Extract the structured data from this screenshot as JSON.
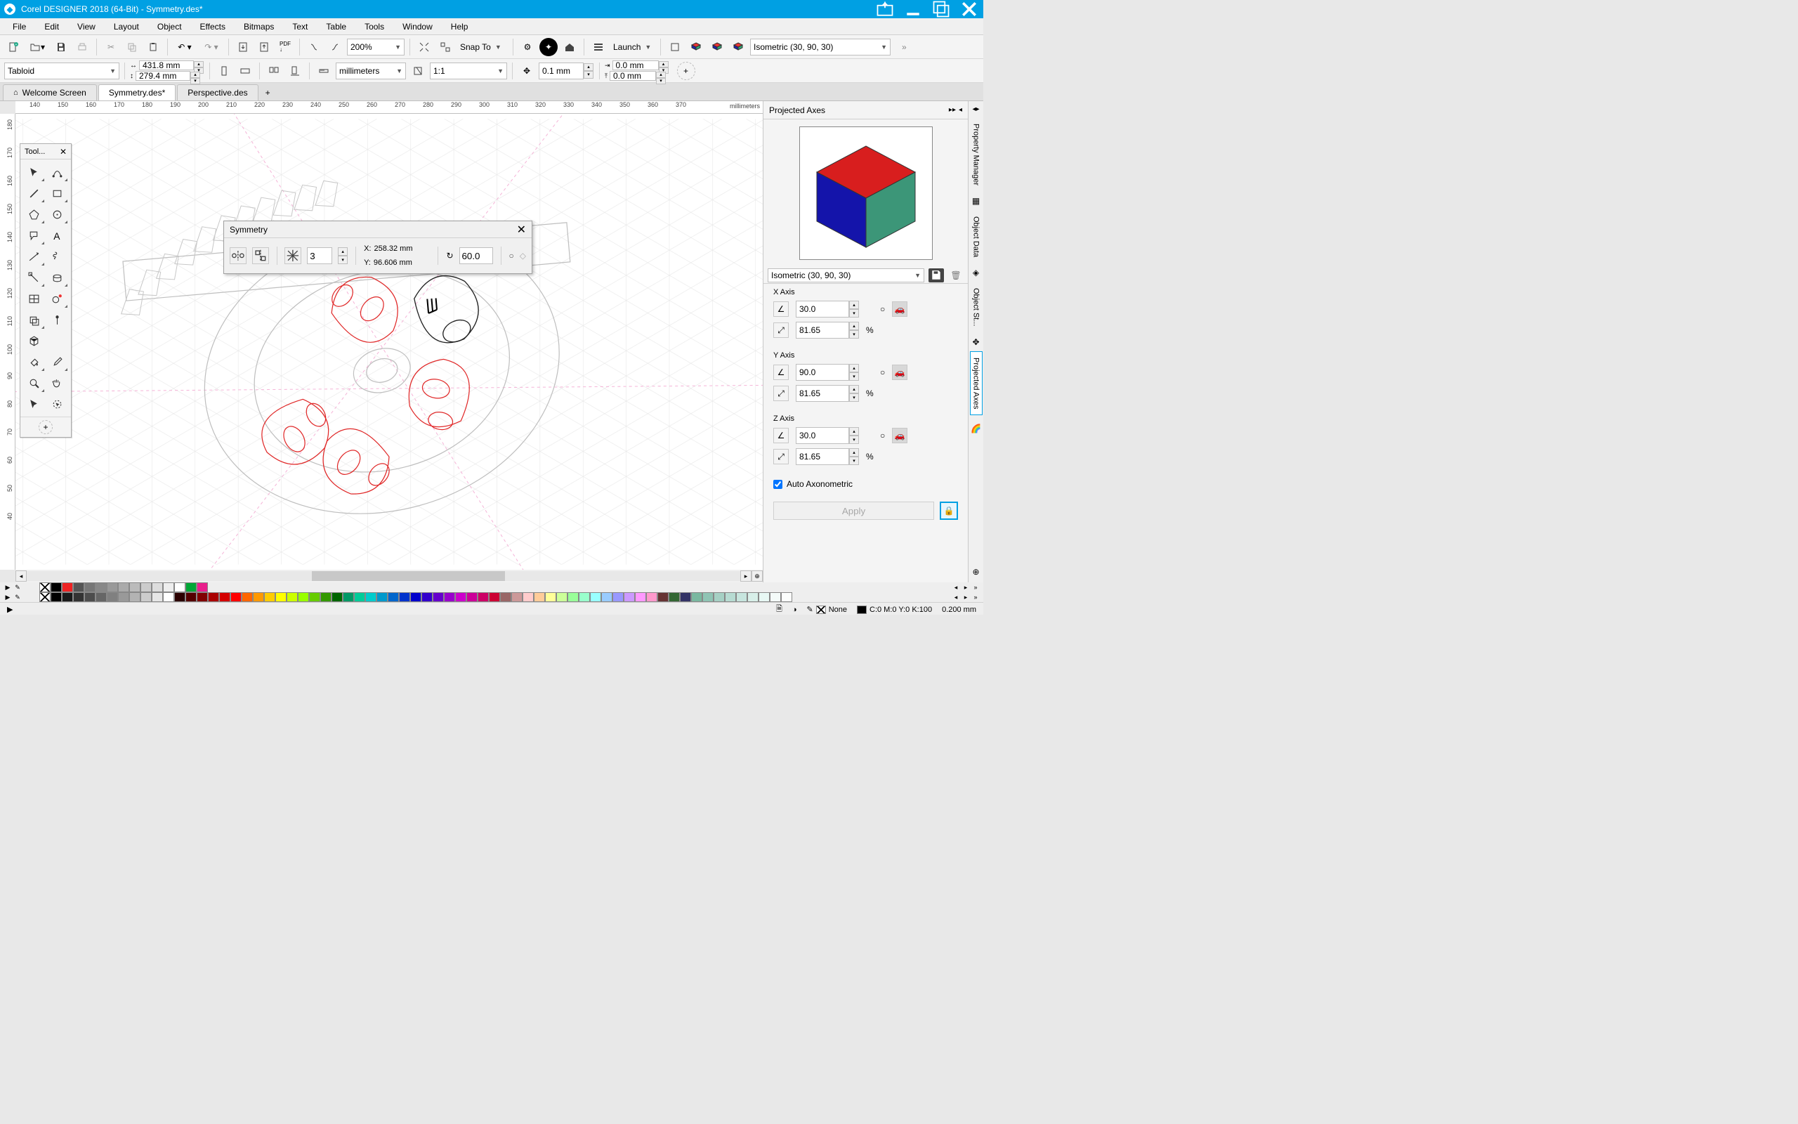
{
  "app": {
    "title": "Corel DESIGNER 2018 (64-Bit) - Symmetry.des*"
  },
  "menu": [
    "File",
    "Edit",
    "View",
    "Layout",
    "Object",
    "Effects",
    "Bitmaps",
    "Text",
    "Table",
    "Tools",
    "Window",
    "Help"
  ],
  "toolbar": {
    "zoom": "200%",
    "snap": "Snap To",
    "launch": "Launch",
    "projection": "Isometric (30, 90, 30)"
  },
  "propbar": {
    "paper": "Tabloid",
    "width": "431.8 mm",
    "height": "279.4 mm",
    "units": "millimeters",
    "scale": "1:1",
    "nudge": "0.1 mm",
    "dupx": "0.0 mm",
    "dupy": "0.0 mm"
  },
  "tabs": [
    {
      "label": "Welcome Screen",
      "active": false,
      "home": true
    },
    {
      "label": "Symmetry.des*",
      "active": true,
      "home": false
    },
    {
      "label": "Perspective.des",
      "active": false,
      "home": false
    }
  ],
  "toolbox_title": "Tool...",
  "ruler_units": "millimeters",
  "ruler_h_ticks": [
    140,
    150,
    160,
    170,
    180,
    190,
    200,
    210,
    220,
    230,
    240,
    250,
    260,
    270,
    280,
    290,
    300,
    310,
    320,
    330,
    340,
    350,
    360,
    370
  ],
  "ruler_v_ticks": [
    180,
    170,
    160,
    150,
    140,
    130,
    120,
    110,
    100,
    90,
    80,
    70,
    60,
    50,
    40
  ],
  "symmetry": {
    "title": "Symmetry",
    "copies": "3",
    "x_lbl": "X:",
    "x": "258.32 mm",
    "y_lbl": "Y:",
    "y": "96.606 mm",
    "angle": "60.0"
  },
  "docker": {
    "title": "Projected Axes",
    "preset": "Isometric (30, 90, 30)",
    "x_lbl": "X Axis",
    "y_lbl": "Y Axis",
    "z_lbl": "Z Axis",
    "x_ang": "30.0",
    "x_sc": "81.65",
    "y_ang": "90.0",
    "y_sc": "81.65",
    "z_ang": "30.0",
    "z_sc": "81.65",
    "pct": "%",
    "auto_lbl": "Auto Axonometric",
    "apply": "Apply"
  },
  "rail": [
    "Property Manager",
    "Object Data",
    "Object St...",
    "Projected Axes"
  ],
  "status": {
    "cursor": "▶",
    "fill_none": "None",
    "cmyk": "C:0 M:0 Y:0 K:100",
    "outline": "0.200 mm"
  },
  "palette1": [
    "#000000",
    "#ee2222",
    "#555555",
    "#777777",
    "#888888",
    "#999999",
    "#aaaaaa",
    "#bbbbbb",
    "#cccccc",
    "#dddddd",
    "#eeeeee",
    "#ffffff",
    "#00a736",
    "#e91e8c"
  ],
  "palette2": [
    "#000000",
    "#1b1b1b",
    "#333333",
    "#4d4d4d",
    "#666666",
    "#808080",
    "#999999",
    "#b3b3b3",
    "#cccccc",
    "#e6e6e6",
    "#ffffff",
    "#2b0000",
    "#550000",
    "#800000",
    "#aa0000",
    "#d40000",
    "#ff0000",
    "#ff6600",
    "#ff9900",
    "#ffcc00",
    "#ffff00",
    "#ccff00",
    "#99ff00",
    "#66cc00",
    "#339900",
    "#006600",
    "#009966",
    "#00cc99",
    "#00cccc",
    "#0099cc",
    "#0066cc",
    "#0033cc",
    "#0000cc",
    "#3300cc",
    "#6600cc",
    "#9900cc",
    "#cc00cc",
    "#cc0099",
    "#cc0066",
    "#cc0033",
    "#996666",
    "#cc9999",
    "#ffcccc",
    "#ffcc99",
    "#ffff99",
    "#ccff99",
    "#99ff99",
    "#99ffcc",
    "#99ffff",
    "#99ccff",
    "#9999ff",
    "#cc99ff",
    "#ff99ff",
    "#ff99cc",
    "#663333",
    "#336633",
    "#333366",
    "#7ab8a0",
    "#8fc4b4",
    "#a6d0c4",
    "#b7dbd2",
    "#c7e5de",
    "#d8efe9",
    "#e8f8f4",
    "#f4fbf9",
    "#fcfefd"
  ]
}
